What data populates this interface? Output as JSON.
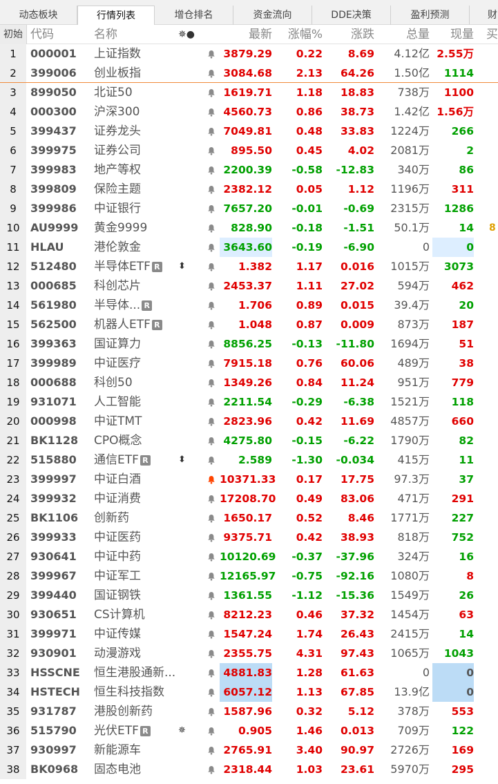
{
  "tabs": [
    {
      "label": "动态板块",
      "active": false
    },
    {
      "label": "行情列表",
      "active": true
    },
    {
      "label": "增仓排名",
      "active": false
    },
    {
      "label": "资金流向",
      "active": false
    },
    {
      "label": "DDE决策",
      "active": false
    },
    {
      "label": "盈利预测",
      "active": false
    },
    {
      "label": "财",
      "active": false
    }
  ],
  "header": {
    "index": "初始",
    "code": "代码",
    "name": "名称",
    "icons": "✵●",
    "price": "最新",
    "pct": "涨幅%",
    "change": "涨跌",
    "volume": "总量",
    "current": "现量",
    "extra": "买"
  },
  "colors": {
    "up": "#e00000",
    "down": "#00a000",
    "highlight": "#ddeeff",
    "divider": "#f08a3a"
  },
  "rows": [
    {
      "idx": "1",
      "code": "000001",
      "name": "上证指数",
      "price": "3879.29",
      "pct": "0.22",
      "change": "8.69",
      "vol": "4.12",
      "unit": "亿",
      "cur": "2.55万",
      "dir": "up",
      "curdir": "up"
    },
    {
      "idx": "2",
      "code": "399006",
      "name": "创业板指",
      "price": "3084.68",
      "pct": "2.13",
      "change": "64.26",
      "vol": "1.50",
      "unit": "亿",
      "cur": "1114",
      "dir": "up",
      "curdir": "down"
    },
    {
      "idx": "3",
      "code": "899050",
      "name": "北证50",
      "price": "1619.71",
      "pct": "1.18",
      "change": "18.83",
      "vol": "738",
      "unit": "万",
      "cur": "1100",
      "dir": "up",
      "curdir": "up"
    },
    {
      "idx": "4",
      "code": "000300",
      "name": "沪深300",
      "price": "4560.73",
      "pct": "0.86",
      "change": "38.73",
      "vol": "1.42",
      "unit": "亿",
      "cur": "1.56万",
      "dir": "up",
      "curdir": "up"
    },
    {
      "idx": "5",
      "code": "399437",
      "name": "证券龙头",
      "price": "7049.81",
      "pct": "0.48",
      "change": "33.83",
      "vol": "1224",
      "unit": "万",
      "cur": "266",
      "dir": "up",
      "curdir": "down"
    },
    {
      "idx": "6",
      "code": "399975",
      "name": "证券公司",
      "price": "895.50",
      "pct": "0.45",
      "change": "4.02",
      "vol": "2081",
      "unit": "万",
      "cur": "2",
      "dir": "up",
      "curdir": "down"
    },
    {
      "idx": "7",
      "code": "399983",
      "name": "地产等权",
      "price": "2200.39",
      "pct": "-0.58",
      "change": "-12.83",
      "vol": "340",
      "unit": "万",
      "cur": "86",
      "dir": "down",
      "curdir": "down"
    },
    {
      "idx": "8",
      "code": "399809",
      "name": "保险主题",
      "price": "2382.12",
      "pct": "0.05",
      "change": "1.12",
      "vol": "1196",
      "unit": "万",
      "cur": "311",
      "dir": "up",
      "curdir": "up"
    },
    {
      "idx": "9",
      "code": "399986",
      "name": "中证银行",
      "price": "7657.20",
      "pct": "-0.01",
      "change": "-0.69",
      "vol": "2315",
      "unit": "万",
      "cur": "1286",
      "dir": "down",
      "curdir": "down"
    },
    {
      "idx": "10",
      "code": "AU9999",
      "name": "黄金9999",
      "price": "828.90",
      "pct": "-0.18",
      "change": "-1.51",
      "vol": "50.1",
      "unit": "万",
      "cur": "14",
      "dir": "down",
      "curdir": "down",
      "edge": "8"
    },
    {
      "idx": "11",
      "code": "HLAU",
      "name": "港伦敦金",
      "price": "3643.60",
      "pct": "-0.19",
      "change": "-6.90",
      "vol": "0",
      "unit": "",
      "cur": "0",
      "dir": "down",
      "curdir": "down",
      "hl": true
    },
    {
      "idx": "12",
      "code": "512480",
      "name": "半导体ETF",
      "badge": "R",
      "flag": "⬍",
      "price": "1.382",
      "pct": "1.17",
      "change": "0.016",
      "vol": "1015",
      "unit": "万",
      "cur": "3073",
      "dir": "up",
      "curdir": "down"
    },
    {
      "idx": "13",
      "code": "000685",
      "name": "科创芯片",
      "price": "2453.37",
      "pct": "1.11",
      "change": "27.02",
      "vol": "594",
      "unit": "万",
      "cur": "462",
      "dir": "up",
      "curdir": "up"
    },
    {
      "idx": "14",
      "code": "561980",
      "name": "半导体...",
      "badge": "R",
      "price": "1.706",
      "pct": "0.89",
      "change": "0.015",
      "vol": "39.4",
      "unit": "万",
      "cur": "20",
      "dir": "up",
      "curdir": "down"
    },
    {
      "idx": "15",
      "code": "562500",
      "name": "机器人ETF",
      "badge": "R",
      "price": "1.048",
      "pct": "0.87",
      "change": "0.009",
      "vol": "873",
      "unit": "万",
      "cur": "187",
      "dir": "up",
      "curdir": "up"
    },
    {
      "idx": "16",
      "code": "399363",
      "name": "国证算力",
      "price": "8856.25",
      "pct": "-0.13",
      "change": "-11.80",
      "vol": "1694",
      "unit": "万",
      "cur": "51",
      "dir": "down",
      "curdir": "up"
    },
    {
      "idx": "17",
      "code": "399989",
      "name": "中证医疗",
      "price": "7915.18",
      "pct": "0.76",
      "change": "60.06",
      "vol": "489",
      "unit": "万",
      "cur": "38",
      "dir": "up",
      "curdir": "up"
    },
    {
      "idx": "18",
      "code": "000688",
      "name": "科创50",
      "price": "1349.26",
      "pct": "0.84",
      "change": "11.24",
      "vol": "951",
      "unit": "万",
      "cur": "779",
      "dir": "up",
      "curdir": "up"
    },
    {
      "idx": "19",
      "code": "931071",
      "name": "人工智能",
      "price": "2211.54",
      "pct": "-0.29",
      "change": "-6.38",
      "vol": "1521",
      "unit": "万",
      "cur": "118",
      "dir": "down",
      "curdir": "down"
    },
    {
      "idx": "20",
      "code": "000998",
      "name": "中证TMT",
      "price": "2823.96",
      "pct": "0.42",
      "change": "11.69",
      "vol": "4857",
      "unit": "万",
      "cur": "660",
      "dir": "up",
      "curdir": "up"
    },
    {
      "idx": "21",
      "code": "BK1128",
      "name": "CPO概念",
      "price": "4275.80",
      "pct": "-0.15",
      "change": "-6.22",
      "vol": "1790",
      "unit": "万",
      "cur": "82",
      "dir": "down",
      "curdir": "down"
    },
    {
      "idx": "22",
      "code": "515880",
      "name": "通信ETF",
      "badge": "R",
      "flag": "⬍",
      "price": "2.589",
      "pct": "-1.30",
      "change": "-0.034",
      "vol": "415",
      "unit": "万",
      "cur": "11",
      "dir": "down",
      "curdir": "down"
    },
    {
      "idx": "23",
      "code": "399997",
      "name": "中证白酒",
      "price": "10371.33",
      "pct": "0.17",
      "change": "17.75",
      "vol": "97.3",
      "unit": "万",
      "cur": "37",
      "dir": "up",
      "curdir": "down",
      "bellred": true
    },
    {
      "idx": "24",
      "code": "399932",
      "name": "中证消费",
      "price": "17208.70",
      "pct": "0.49",
      "change": "83.06",
      "vol": "471",
      "unit": "万",
      "cur": "291",
      "dir": "up",
      "curdir": "up"
    },
    {
      "idx": "25",
      "code": "BK1106",
      "name": "创新药",
      "price": "1650.17",
      "pct": "0.52",
      "change": "8.46",
      "vol": "1771",
      "unit": "万",
      "cur": "227",
      "dir": "up",
      "curdir": "down"
    },
    {
      "idx": "26",
      "code": "399933",
      "name": "中证医药",
      "price": "9375.71",
      "pct": "0.42",
      "change": "38.93",
      "vol": "818",
      "unit": "万",
      "cur": "752",
      "dir": "up",
      "curdir": "down"
    },
    {
      "idx": "27",
      "code": "930641",
      "name": "中证中药",
      "price": "10120.69",
      "pct": "-0.37",
      "change": "-37.96",
      "vol": "324",
      "unit": "万",
      "cur": "16",
      "dir": "down",
      "curdir": "down"
    },
    {
      "idx": "28",
      "code": "399967",
      "name": "中证军工",
      "price": "12165.97",
      "pct": "-0.75",
      "change": "-92.16",
      "vol": "1080",
      "unit": "万",
      "cur": "8",
      "dir": "down",
      "curdir": "up"
    },
    {
      "idx": "29",
      "code": "399440",
      "name": "国证钢铁",
      "price": "1361.55",
      "pct": "-1.12",
      "change": "-15.36",
      "vol": "1549",
      "unit": "万",
      "cur": "26",
      "dir": "down",
      "curdir": "down"
    },
    {
      "idx": "30",
      "code": "930651",
      "name": "CS计算机",
      "price": "8212.23",
      "pct": "0.46",
      "change": "37.32",
      "vol": "1454",
      "unit": "万",
      "cur": "63",
      "dir": "up",
      "curdir": "up"
    },
    {
      "idx": "31",
      "code": "399971",
      "name": "中证传媒",
      "price": "1547.24",
      "pct": "1.74",
      "change": "26.43",
      "vol": "2415",
      "unit": "万",
      "cur": "14",
      "dir": "up",
      "curdir": "down"
    },
    {
      "idx": "32",
      "code": "930901",
      "name": "动漫游戏",
      "price": "2355.75",
      "pct": "4.31",
      "change": "97.43",
      "vol": "1065",
      "unit": "万",
      "cur": "1043",
      "dir": "up",
      "curdir": "down"
    },
    {
      "idx": "33",
      "code": "HSSCNE",
      "name": "恒生港股通新...",
      "price": "4881.83",
      "pct": "1.28",
      "change": "61.63",
      "vol": "0",
      "unit": "",
      "cur": "0",
      "dir": "up",
      "curdir": "gray",
      "hl2": true
    },
    {
      "idx": "34",
      "code": "HSTECH",
      "name": "恒生科技指数",
      "price": "6057.12",
      "pct": "1.13",
      "change": "67.85",
      "vol": "13.9",
      "unit": "亿",
      "cur": "0",
      "dir": "up",
      "curdir": "gray",
      "hl2": true
    },
    {
      "idx": "35",
      "code": "931787",
      "name": "港股创新药",
      "price": "1587.96",
      "pct": "0.32",
      "change": "5.12",
      "vol": "378",
      "unit": "万",
      "cur": "553",
      "dir": "up",
      "curdir": "up"
    },
    {
      "idx": "36",
      "code": "515790",
      "name": "光伏ETF",
      "badge": "R",
      "flag": "✵",
      "price": "0.905",
      "pct": "1.46",
      "change": "0.013",
      "vol": "709",
      "unit": "万",
      "cur": "122",
      "dir": "up",
      "curdir": "down"
    },
    {
      "idx": "37",
      "code": "930997",
      "name": "新能源车",
      "price": "2765.91",
      "pct": "3.40",
      "change": "90.97",
      "vol": "2726",
      "unit": "万",
      "cur": "169",
      "dir": "up",
      "curdir": "up"
    },
    {
      "idx": "38",
      "code": "BK0968",
      "name": "固态电池",
      "price": "2318.44",
      "pct": "1.03",
      "change": "23.61",
      "vol": "5970",
      "unit": "万",
      "cur": "295",
      "dir": "up",
      "curdir": "up"
    }
  ]
}
